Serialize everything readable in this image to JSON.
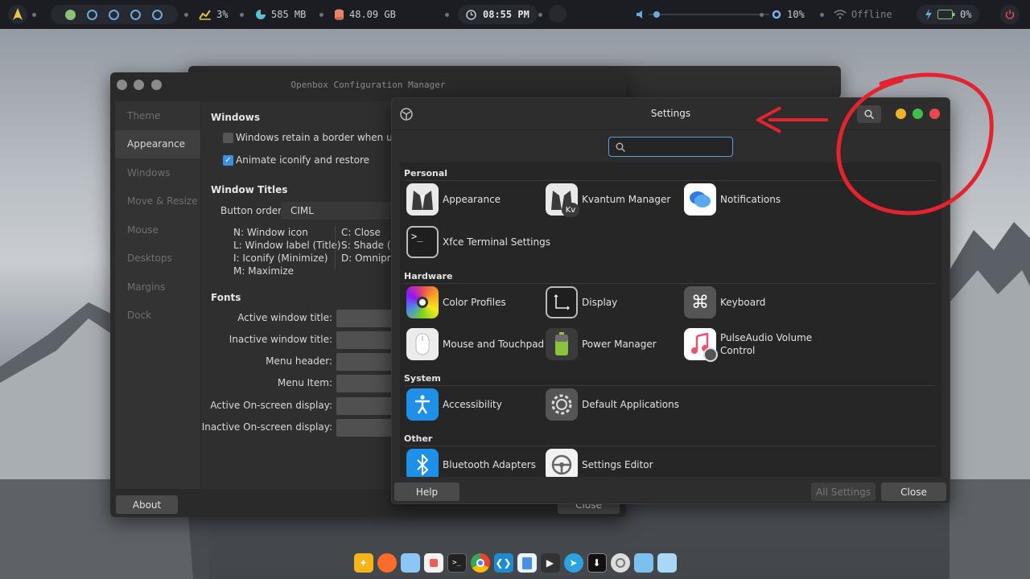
{
  "panel": {
    "launcher_icon": "arch-icon",
    "cpu": "3%",
    "memory": "585 MB",
    "disk": "48.09 GB",
    "clock": "08:55 PM",
    "brightness": "10%",
    "network": "Offline",
    "battery": "0%"
  },
  "openbox": {
    "title": "Openbox Configuration Manager",
    "sidebar": [
      "Theme",
      "Appearance",
      "Windows",
      "Move & Resize",
      "Mouse",
      "Desktops",
      "Margins",
      "Dock"
    ],
    "selected": "Appearance",
    "windows_heading": "Windows",
    "opt_border": "Windows retain a border when undec",
    "opt_animate": "Animate iconify and restore",
    "titles_heading": "Window Titles",
    "button_order_label": "Button order:",
    "button_order_value": "CIML",
    "legend": {
      "n": "N:  Window icon",
      "l": "L:   Window label (Title)",
      "i": "I:    Iconify (Minimize)",
      "m": "M:  Maximize",
      "c": "C:  Close",
      "s": "S:  Shade (F",
      "d": "D:  Omnipre"
    },
    "fonts_heading": "Fonts",
    "fonts": [
      "Active window title:",
      "Inactive window title:",
      "Menu header:",
      "Menu Item:",
      "Active On-screen display:",
      "Inactive On-screen display:"
    ],
    "about": "About",
    "close": "Close"
  },
  "settings": {
    "title": "Settings",
    "search_placeholder": "",
    "categories": {
      "personal": "Personal",
      "hardware": "Hardware",
      "system": "System",
      "other": "Other"
    },
    "items": {
      "appearance": "Appearance",
      "kvantum": "Kvantum Manager",
      "notifications": "Notifications",
      "terminal": "Xfce Terminal Settings",
      "color_profiles": "Color Profiles",
      "display": "Display",
      "keyboard": "Keyboard",
      "mouse": "Mouse and Touchpad",
      "power": "Power Manager",
      "pulse_1": "PulseAudio Volume",
      "pulse_2": "Control",
      "accessibility": "Accessibility",
      "default_apps": "Default Applications",
      "bluetooth": "Bluetooth Adapters",
      "settings_editor": "Settings Editor"
    },
    "help": "Help",
    "all_settings": "All Settings",
    "close": "Close"
  },
  "dock_icons": [
    "files-icon",
    "firefox-icon",
    "folder-icon",
    "apps-icon",
    "terminal-icon",
    "chrome-icon",
    "vscode-icon",
    "document-icon",
    "video-icon",
    "telegram-icon",
    "download-icon",
    "settings-icon",
    "folder-icon",
    "window-icon"
  ],
  "colors": {
    "accent": "#3d8ee5",
    "traffic_yellow": "#f0b429",
    "traffic_green": "#3fbf4a",
    "traffic_red": "#e5484d",
    "annotation_red": "#e4232f"
  }
}
